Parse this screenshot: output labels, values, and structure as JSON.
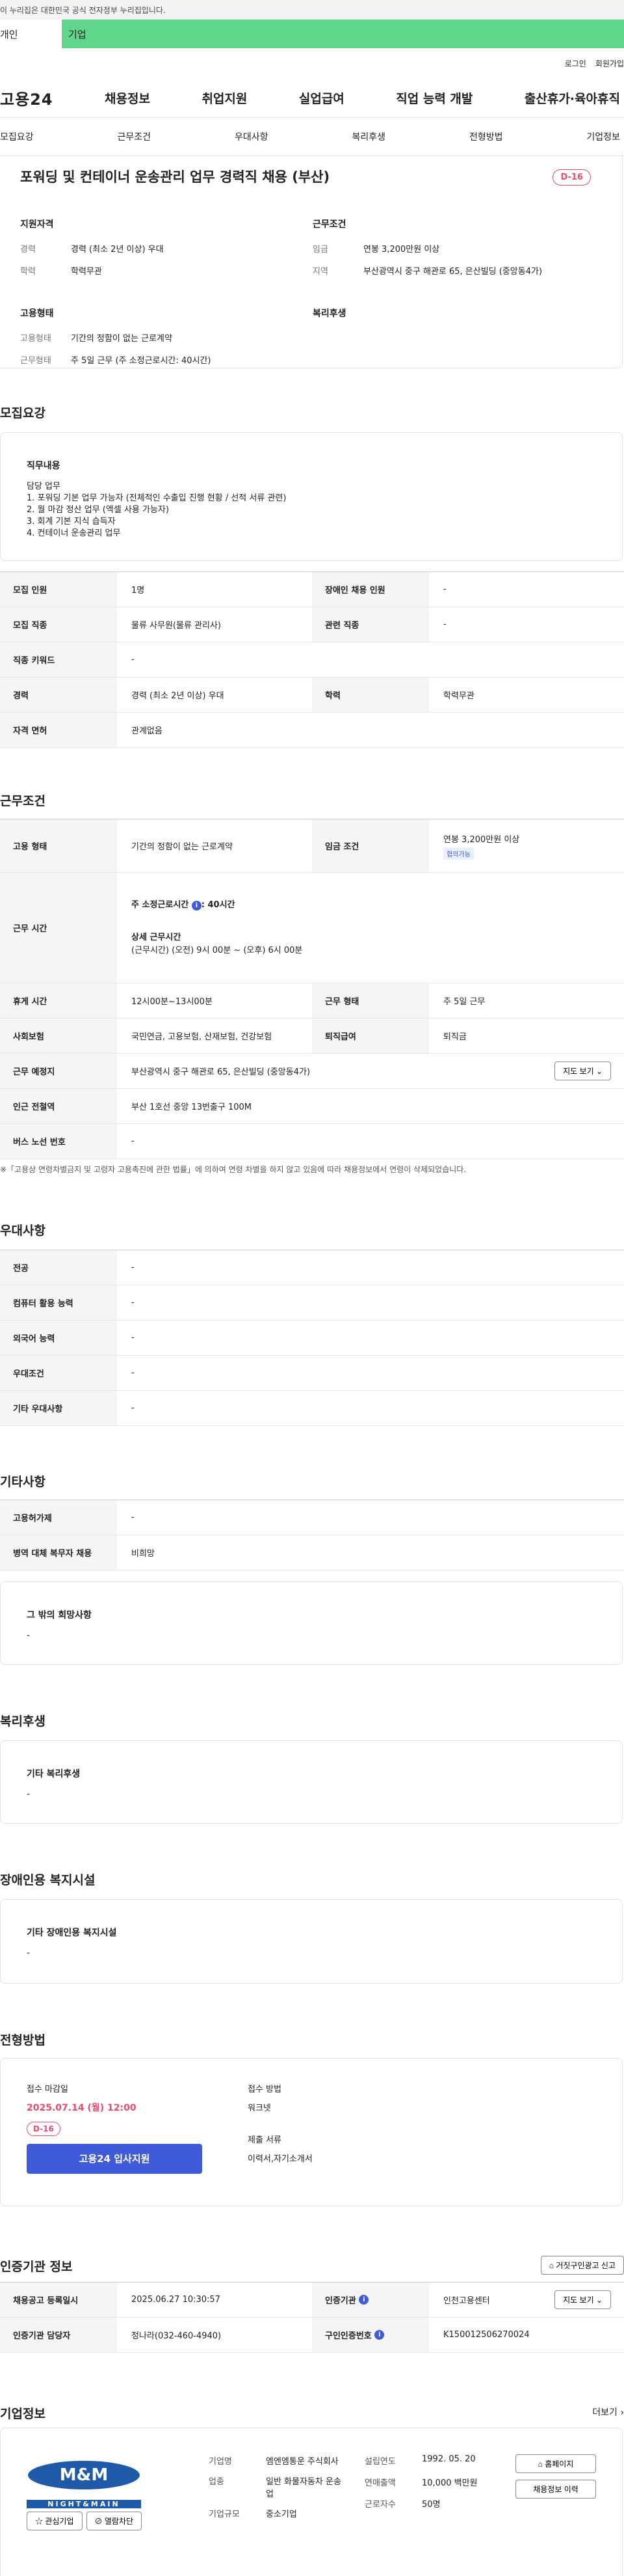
{
  "gov_banner": "이 누리집은 대한민국 공식 전자정부 누리집입니다.",
  "top_tabs": [
    "개인",
    "기업"
  ],
  "util_links": [
    "로그인",
    "회원가입"
  ],
  "logo": "고용24",
  "gnb": [
    "채용정보",
    "취업지원",
    "실업급여",
    "직업 능력 개발",
    "출산휴가·육아휴직"
  ],
  "subnav": [
    "모집요강",
    "근무조건",
    "우대사항",
    "복리후생",
    "전형방법",
    "기업정보"
  ],
  "job_title": "포워딩 및 컨테이너 운송관리 업무 경력직 채용 (부산)",
  "dday": "D-16",
  "summary": {
    "qual_h": "지원자격",
    "qual": [
      [
        "경력",
        "경력 (최소 2년 이상) 우대"
      ],
      [
        "학력",
        "학력무관"
      ]
    ],
    "emp_h": "고용형태",
    "emp": [
      [
        "고용형태",
        "기간의 정함이 없는 근로계약"
      ],
      [
        "근무형태",
        "주 5일 근무 (주 소정근로시간: 40시간)"
      ]
    ],
    "cond_h": "근무조건",
    "cond": [
      [
        "임금",
        "연봉 3,200만원 이상"
      ],
      [
        "지역",
        "부산광역시 중구 해관로 65, 은산빌딩 (중앙동4가)"
      ]
    ],
    "welfare_h": "복리후생"
  },
  "recruit": {
    "heading": "모집요강",
    "duty_h": "직무내용",
    "duty_lines": [
      "담당 업무",
      "1. 포워딩 기본 업무 가능자 (전체적인 수출입 진행 현황 / 선적 서류 관련)",
      "2. 월 마감 정산 업무 (엑셀 사용 가능자)",
      "3. 회계 기본 지식 습득자",
      "4. 컨테이너 운송관리 업무"
    ],
    "rows": [
      [
        "모집 인원",
        "1명",
        "장애인 채용 인원",
        "-"
      ],
      [
        "모집 직종",
        "물류 사무원(물류 관리사)",
        "관련 직종",
        "-"
      ],
      [
        "직종 키워드",
        "-"
      ],
      [
        "경력",
        "경력 (최소 2년 이상) 우대",
        "학력",
        "학력무관"
      ],
      [
        "자격 면허",
        "관계없음"
      ]
    ]
  },
  "work": {
    "heading": "근무조건",
    "r1": [
      "고용 형태",
      "기간의 정함이 없는 근로계약",
      "임금 조건",
      "연봉 3,200만원 이상",
      "협의가능"
    ],
    "hours_h": "근무 시간",
    "hours_weekly_label": "주 소정근로시간",
    "hours_weekly": ": 40시간",
    "hours_detail_h": "상세 근무시간",
    "hours_detail": "(근무시간) (오전) 9시 00분 ~ (오후) 6시 00분",
    "r3": [
      "휴게 시간",
      "12시00분~13시00분",
      "근무 형태",
      "주 5일 근무"
    ],
    "r4": [
      "사회보험",
      "국민연금, 고용보험, 산재보험, 건강보험",
      "퇴직급여",
      "퇴직금"
    ],
    "r5": [
      "근무 예정지",
      "부산광역시 중구 해관로 65, 은산빌딩 (중앙동4가)",
      "지도 보기"
    ],
    "r6": [
      "인근 전철역",
      "부산 1호선 중앙 13번출구 100M"
    ],
    "r7": [
      "버스 노선 번호",
      "-"
    ],
    "note": "※「고용상 연령차별금지 및 고령자 고용촉진에 관한 법률」에 의하여 연령 차별을 하지 않고 있음에 따라 채용정보에서 연령이 삭제되었습니다."
  },
  "pref": {
    "heading": "우대사항",
    "rows": [
      [
        "전공",
        "-"
      ],
      [
        "컴퓨터 활용 능력",
        "-"
      ],
      [
        "외국어 능력",
        "-"
      ],
      [
        "우대조건",
        "-"
      ],
      [
        "기타 우대사항",
        "-"
      ]
    ]
  },
  "etc": {
    "heading": "기타사항",
    "rows": [
      [
        "고용허가제",
        "-"
      ],
      [
        "병역 대체 복무자 채용",
        "비희망"
      ]
    ],
    "wish_h": "그 밖의 희망사항",
    "wish": "-"
  },
  "welfare": {
    "heading": "복리후생",
    "h": "기타 복리후생",
    "v": "-"
  },
  "disab": {
    "heading": "장애인용 복지시설",
    "h": "기타 장애인용 복지시설",
    "v": "-"
  },
  "process": {
    "heading": "전형방법",
    "deadline_h": "접수 마감일",
    "deadline": "2025.07.14 (월) 12:00",
    "dday": "D-16",
    "apply": "고용24 입사지원",
    "method_h": "접수 방법",
    "method": "워크넷",
    "docs_h": "제출 서류",
    "docs": "이력서,자기소개서"
  },
  "cert": {
    "heading": "인증기관 정보",
    "report": "거짓구인광고 신고",
    "rows": [
      [
        "채용공고 등록일시",
        "2025.06.27 10:30:57",
        "인증기관",
        "인천고용센터",
        "지도 보기"
      ],
      [
        "인증기관 담당자",
        "정나라(032-460-4940)",
        "구인인증번호",
        "K150012506270024"
      ]
    ]
  },
  "company": {
    "heading": "기업정보",
    "more": "더보기",
    "fav": "관심기업",
    "block": "열람차단",
    "info": [
      [
        "기업명",
        "엠엔엠통운 주식회사"
      ],
      [
        "업종",
        "일반 화물자동차 운송업"
      ],
      [
        "기업규모",
        "중소기업"
      ]
    ],
    "info2": [
      [
        "설립연도",
        "1992. 05. 20"
      ],
      [
        "연매출액",
        "10,000 백만원"
      ],
      [
        "근로자수",
        "50명"
      ]
    ],
    "btn1": "홈페이지",
    "btn2": "채용정보 이력",
    "logo_text": "NIGHT&MAIN",
    "logo_sub": "M&M"
  }
}
